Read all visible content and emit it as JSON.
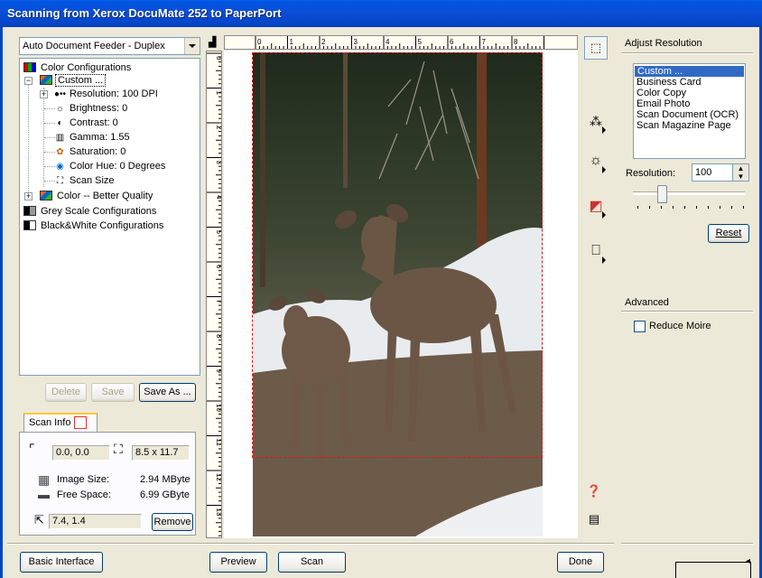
{
  "window": {
    "title": "Scanning from Xerox DocuMate 252 to PaperPort"
  },
  "source_combo": {
    "value": "Auto Document Feeder - Duplex"
  },
  "tree": {
    "root": "Color Configurations",
    "custom": "Custom ...",
    "children": [
      {
        "icon": "dots-icon",
        "label": "Resolution: 100 DPI"
      },
      {
        "icon": "sun-icon",
        "label": "Brightness: 0"
      },
      {
        "icon": "contrast-icon",
        "label": "Contrast: 0"
      },
      {
        "icon": "gamma-icon",
        "label": "Gamma: 1.55"
      },
      {
        "icon": "saturation-icon",
        "label": "Saturation: 0"
      },
      {
        "icon": "hue-icon",
        "label": "Color Hue: 0 Degrees"
      },
      {
        "icon": "scan-size-icon",
        "label": "Scan Size"
      }
    ],
    "color_better": "Color -- Better Quality",
    "grey": "Grey Scale Configurations",
    "bw": "Black&White Configurations"
  },
  "config_buttons": {
    "delete": "Delete",
    "save": "Save",
    "save_as": "Save As ..."
  },
  "scan_info": {
    "tab": "Scan Info",
    "origin": "0.0, 0.0",
    "size": "8.5 x 11.7",
    "image_size_label": "Image Size:",
    "image_size_value": "2.94 MByte",
    "free_space_label": "Free Space:",
    "free_space_value": "6.99 GByte",
    "cursor_pos": "7.4, 1.4",
    "remove": "Remove"
  },
  "ruler": {
    "top_labels": [
      "0",
      "1",
      "2",
      "3",
      "4",
      "5",
      "6",
      "7",
      "8"
    ],
    "left_labels": [
      "0",
      "1",
      "2",
      "3",
      "4",
      "5",
      "6",
      "7",
      "8",
      "9",
      "10",
      "11",
      "12",
      "13"
    ]
  },
  "right_panel": {
    "adjust_title": "Adjust Resolution",
    "presets": [
      "Custom ...",
      "Business Card",
      "Color Copy",
      "Email Photo",
      "Scan Document (OCR)",
      "Scan Magazine Page"
    ],
    "resolution_label": "Resolution:",
    "resolution_value": "100",
    "reset": "Reset",
    "advanced_title": "Advanced",
    "reduce_moire": "Reduce Moire"
  },
  "bottom": {
    "basic_interface": "Basic Interface",
    "preview": "Preview",
    "scan": "Scan",
    "done": "Done"
  }
}
